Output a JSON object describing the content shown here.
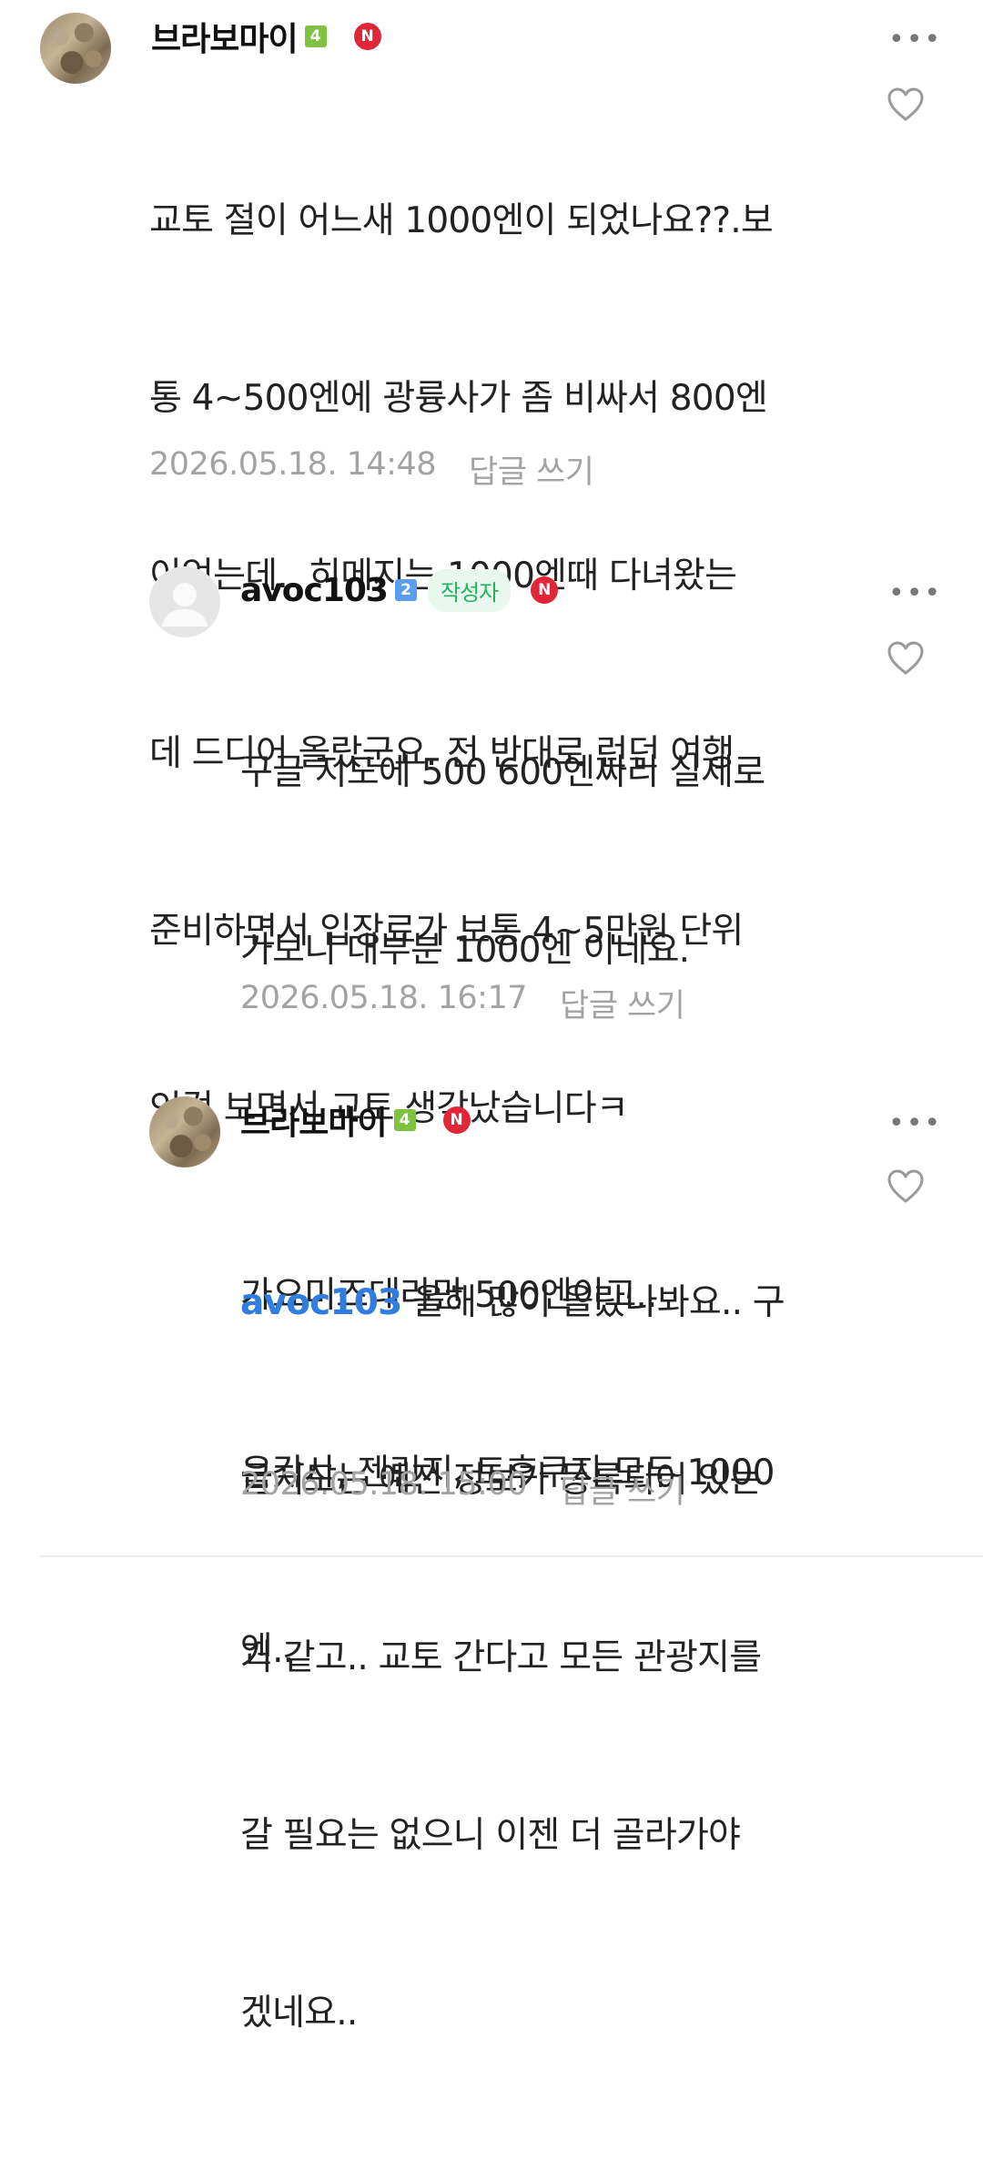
{
  "comments": [
    {
      "nickname": "브라보마이",
      "level": "4",
      "n_badge": "N",
      "more": "•••",
      "lines": [
        "교토 절이 어느새 1000엔이 되었나요??.보",
        "통 4~500엔에 광륭사가 좀 비싸서 800엔",
        "이었는데.. 히메지는 1000엔때 다녀왔는",
        "데 드디어 올랐군요. 전 반대로 런던 여행",
        "준비하면서 입장료가 보통 4~5만원 단위",
        "인걸 보면서 교토 생각났습니다ㅋ"
      ],
      "date": "2026.05.18. 14:48",
      "reply_label": "답글 쓰기"
    },
    {
      "nickname": "avoc103",
      "level": "2",
      "author_badge": "작성자",
      "n_badge": "N",
      "more": "•••",
      "lines": [
        "구글 지도에 500 600엔짜리 실제로",
        "가보니 대부분 1000엔 이네요.",
        "",
        "가요미즈데라만 500엔이고..",
        "은각사, 젠린지, 토후쿠지 모두 1000",
        "엔.."
      ],
      "date": "2026.05.18. 16:17",
      "reply_label": "답글 쓰기"
    },
    {
      "nickname": "브라보마이",
      "level": "4",
      "n_badge": "N",
      "more": "•••",
      "mention": "avoc103",
      "first_line_rest": " 올해 많이 올랐나봐요.. 구",
      "lines": [
        "글지도는 예전 정보가 등록되어 있는",
        "거 같고.. 교토 간다고 모든 관광지를",
        "갈 필요는 없으니 이젠 더 골라가야",
        "겠네요.."
      ],
      "date": "2026.05.18. 15:00",
      "reply_label": "답글 쓰기"
    }
  ],
  "icons": {
    "avatar_photo": "avatar-photo",
    "avatar_default": "default-user-icon",
    "like": "heart-outline-icon",
    "more": "more-horizontal-icon"
  },
  "colors": {
    "level_green": "#7fc242",
    "level_blue": "#5b9ef0",
    "n_badge": "#e2263a",
    "author_badge_text": "#22b35e",
    "mention": "#2f7de1",
    "meta": "#a3a3a3"
  }
}
